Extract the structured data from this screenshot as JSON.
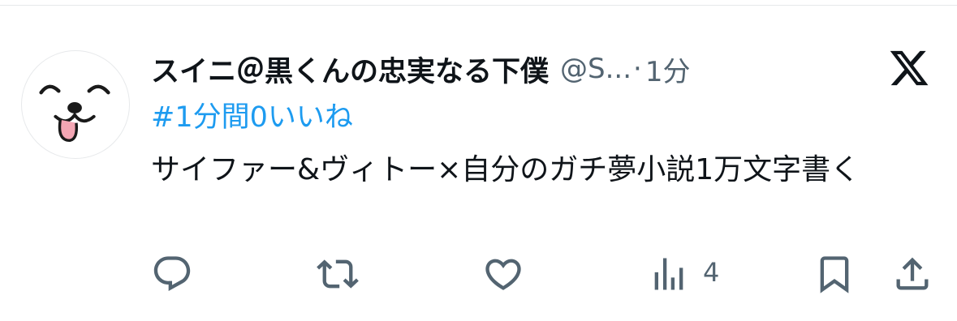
{
  "tweet": {
    "display_name": "スイニ＠黒くんの忠実なる下僕",
    "handle": "@S...",
    "separator": "·",
    "time": "1分",
    "hashtag": "#1分間0いいね",
    "text": "サイファー&ヴィトー×自分のガチ夢小説1万文字書く"
  },
  "actions": {
    "reply_icon": "reply-icon",
    "retweet_icon": "retweet-icon",
    "like_icon": "like-icon",
    "views_icon": "views-icon",
    "views_count": "4",
    "bookmark_icon": "bookmark-icon",
    "share_icon": "share-icon"
  },
  "colors": {
    "text": "#0f1419",
    "secondary": "#536471",
    "link": "#1d9bf0",
    "icon": "#536471"
  },
  "brand_icon": "x-logo"
}
